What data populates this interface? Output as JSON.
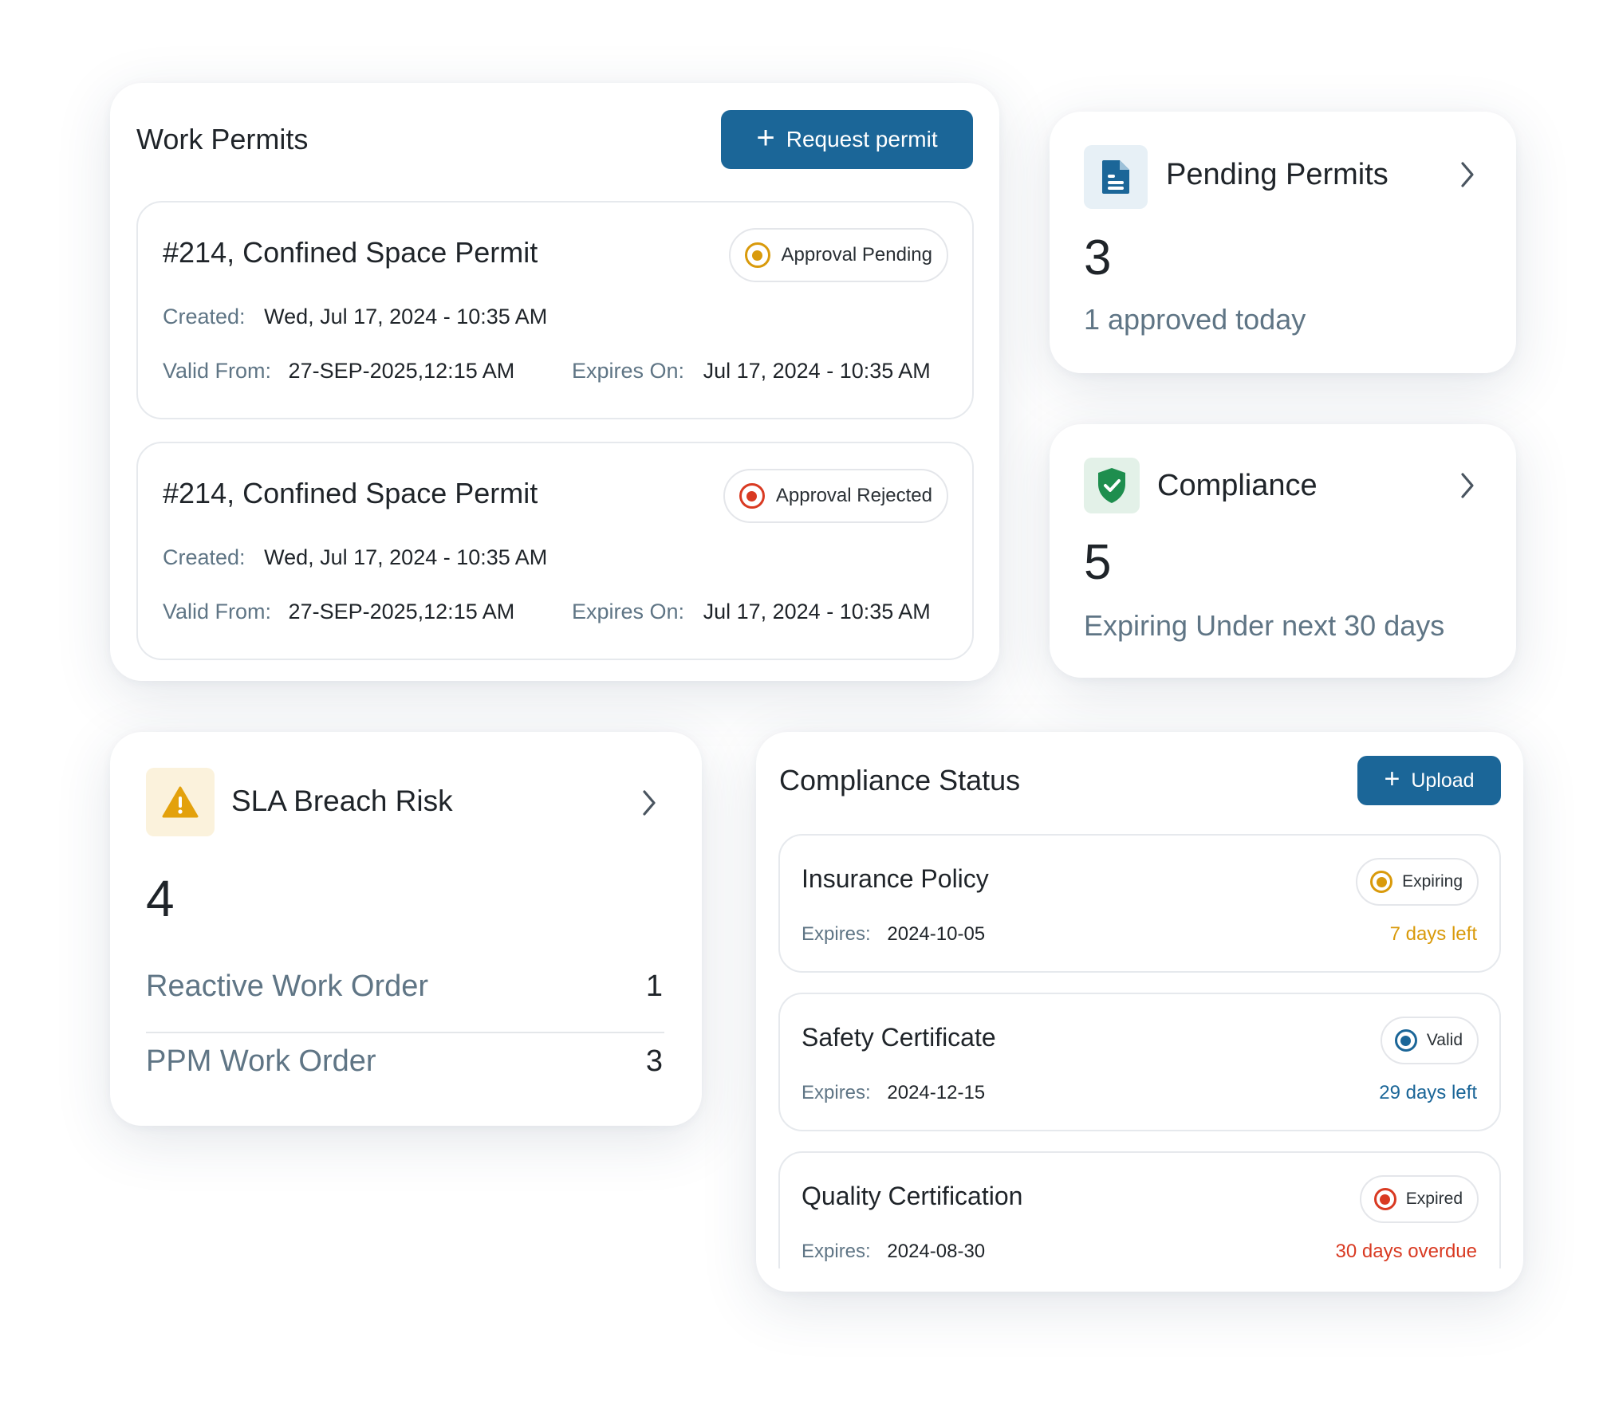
{
  "work_permits": {
    "title": "Work Permits",
    "request_button": "Request permit",
    "permits": [
      {
        "title": "#214, Confined Space Permit",
        "status": "Approval Pending",
        "status_color": "#d99a0b",
        "created_label": "Created:",
        "created": "Wed, Jul 17, 2024 - 10:35 AM",
        "valid_from_label": "Valid From:",
        "valid_from": "27-SEP-2025,12:15 AM",
        "expires_label": "Expires On:",
        "expires": "Jul 17, 2024 - 10:35 AM"
      },
      {
        "title": "#214, Confined Space Permit",
        "status": "Approval Rejected",
        "status_color": "#d93a22",
        "created_label": "Created:",
        "created": "Wed, Jul 17, 2024 - 10:35 AM",
        "valid_from_label": "Valid From:",
        "valid_from": "27-SEP-2025,12:15 AM",
        "expires_label": "Expires On:",
        "expires": "Jul 17, 2024 - 10:35 AM"
      }
    ]
  },
  "pending_permits": {
    "icon": "document-icon",
    "title": "Pending Permits",
    "count": "3",
    "subtitle": "1 approved today"
  },
  "compliance": {
    "icon": "shield-check-icon",
    "title": "Compliance",
    "count": "5",
    "subtitle": "Expiring Under next 30 days"
  },
  "sla": {
    "icon": "warning-icon",
    "title": "SLA Breach Risk",
    "count": "4",
    "rows": [
      {
        "label": "Reactive Work Order",
        "value": "1"
      },
      {
        "label": "PPM Work Order",
        "value": "3"
      }
    ]
  },
  "compliance_status": {
    "title": "Compliance Status",
    "upload_button": "Upload",
    "items": [
      {
        "name": "Insurance Policy",
        "status": "Expiring",
        "status_color": "#d99a0b",
        "expires_label": "Expires:",
        "expires": "2024-10-05",
        "note": "7 days left"
      },
      {
        "name": "Safety Certificate",
        "status": "Valid",
        "status_color": "#1b6698",
        "expires_label": "Expires:",
        "expires": "2024-12-15",
        "note": "29 days left"
      },
      {
        "name": "Quality Certification",
        "status": "Expired",
        "status_color": "#d93a22",
        "expires_label": "Expires:",
        "expires": "2024-08-30",
        "note": "30 days overdue"
      }
    ]
  },
  "colors": {
    "primary": "#1b6698",
    "pending": "#d99a0b",
    "rejected": "#d93a22",
    "green": "#1e8e4e"
  }
}
